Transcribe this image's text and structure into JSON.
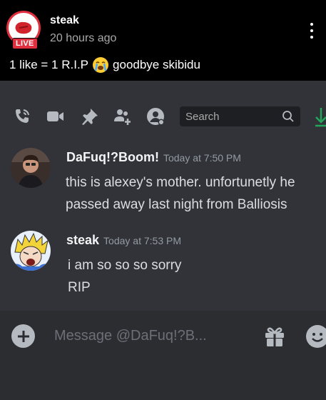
{
  "post": {
    "username": "steak",
    "time": "20 hours ago",
    "live_badge": "LIVE",
    "caption": "1 like = 1 R.I.P",
    "caption_emoji": "loudly-crying-face-emoji",
    "caption_tail": "goodbye skibidu"
  },
  "toolbar": {
    "icons": [
      "phone-call-icon",
      "video-call-icon",
      "pin-icon",
      "add-member-icon",
      "profile-icon"
    ],
    "search_placeholder": "Search"
  },
  "messages": [
    {
      "author": "DaFuq!?Boom!",
      "time": "Today at 7:50 PM",
      "lines": [
        "this is alexey's mother. unfortunetly he",
        "passed away last night from Balliosis"
      ]
    },
    {
      "author": "steak",
      "time": "Today at 7:53 PM",
      "lines": [
        "i am so so so sorry",
        "RIP"
      ]
    }
  ],
  "composer": {
    "placeholder": "Message @DaFuq!?B..."
  },
  "colors": {
    "discord_bg": "#313338",
    "composer_bg": "#2b2d31",
    "live_red": "#e02f3e",
    "download_green": "#23a55a"
  }
}
